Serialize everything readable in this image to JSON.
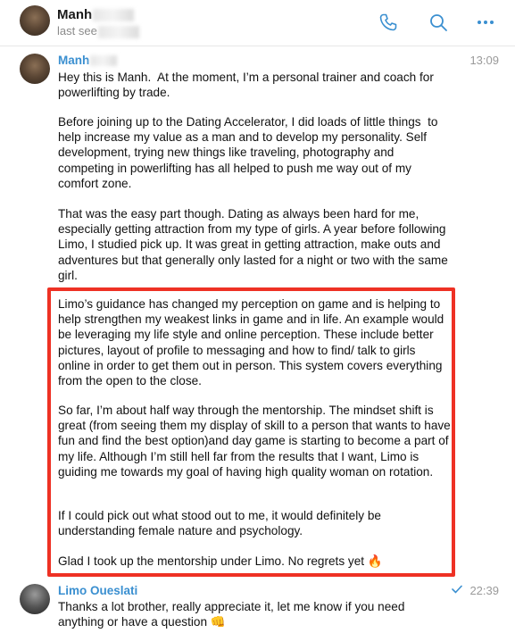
{
  "header": {
    "contact_name": "Manh",
    "status": "last see",
    "icons": [
      "phone-icon",
      "search-icon",
      "more-icon"
    ]
  },
  "messages": [
    {
      "sender": "Manh",
      "time": "13:09",
      "paragraphs": [
        "Hey this is Manh.  At the moment, I’m a personal trainer and coach for powerlifting by trade.",
        "Before joining up to the Dating Accelerator, I did loads of little things  to help increase my value as a man and to develop my personality. Self development, trying new things like traveling, photography and competing in powerlifting has all helped to push me way out of my comfort zone.",
        "That was the easy part though. Dating as always been hard for me, especially getting attraction from my type of girls. A year before following Limo, I studied pick up. It was great in getting attraction, make outs and adventures but that generally only lasted for a night or two with the same girl.",
        "Limo’s guidance has changed my perception on game and is helping to help strengthen my weakest links in game and in life. An example would be leveraging my life style and online perception. These include better pictures, layout of profile to messaging and how to find/ talk to girls online in order to get them out in person. This system covers everything from the open to the close.",
        "So far, I’m about half way through the mentorship. The mindset shift is great (from seeing them my display of skill to a person that wants to have fun and find the best option)and day game is starting to become a part of my life. Although I’m still hell far from the results that I want, Limo is guiding me towards my goal of having high quality woman on rotation.",
        "If I could pick out what stood out to me, it would definitely be understanding female nature and psychology.",
        "Glad I took up the mentorship under Limo. No regrets yet 🔥"
      ]
    },
    {
      "sender": "Limo Oueslati",
      "time": "22:39",
      "text": "Thanks a lot brother, really appreciate it, let me know if you need anything or have a question 👊"
    }
  ],
  "colors": {
    "accent": "#3a8fd0",
    "highlight_border": "#ee3124"
  }
}
